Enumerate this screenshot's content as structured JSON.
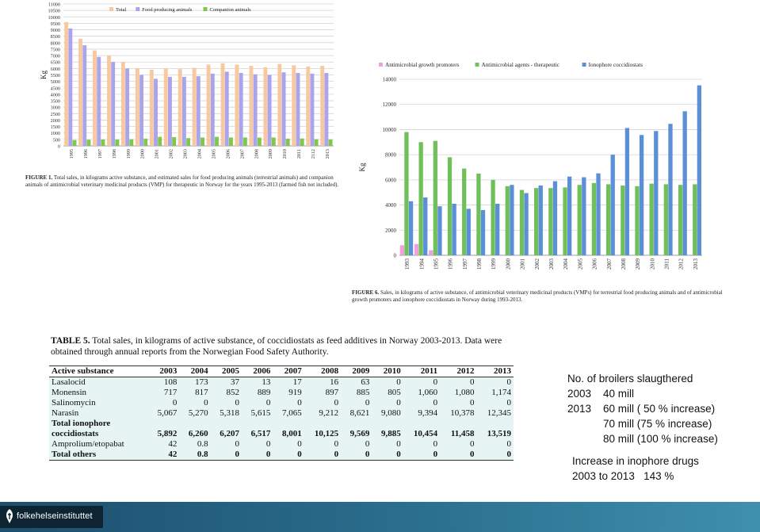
{
  "figure1": {
    "caption_bold": "FIGURE 1.",
    "caption_text": " Total sales, in kilograms active substance, and estimated sales for food producing animals (terrestrial animals) and companion animals of antimicrobial veterinary medicinal products (VMP) for therapeutic in Norway for the years 1995-2013 (farmed fish not included)."
  },
  "figure6": {
    "caption_bold": "FIGURE 6.",
    "caption_text": " Sales, in kilograms of active substance, of antimicrobial veterinary medicinal products (VMPs) for terrestrial food producing animals and of antimicrobial growth promoters and ionophore coccidiostats in Norway during 1993-2013."
  },
  "chart_data": [
    {
      "type": "bar",
      "ylabel": "Kg",
      "ylim": [
        0,
        11000
      ],
      "yticks": [
        "0",
        "500",
        "1000",
        "1500",
        "2000",
        "2500",
        "3000",
        "3500",
        "4000",
        "4500",
        "5000",
        "5500",
        "6000",
        "6500",
        "7000",
        "7500",
        "8000",
        "8500",
        "9000",
        "9500",
        "10000",
        "10500",
        "11000"
      ],
      "grid": true,
      "legend_position": "top",
      "categories": [
        "1995",
        "1996",
        "1997",
        "1998",
        "1999",
        "2000",
        "2001",
        "2002",
        "2003",
        "2004",
        "2005",
        "2006",
        "2007",
        "2008",
        "2009",
        "2010",
        "2011",
        "2112",
        "2013"
      ],
      "series": [
        {
          "name": "Total",
          "color": "#f8c9a0",
          "values": [
            9600,
            8300,
            7400,
            7000,
            6500,
            6000,
            5900,
            6000,
            5950,
            6050,
            6300,
            6400,
            6300,
            6200,
            6100,
            6350,
            6250,
            6150,
            6200
          ]
        },
        {
          "name": "Food producing animals",
          "color": "#a9a4ec",
          "values": [
            9100,
            7800,
            6900,
            6500,
            6000,
            5500,
            5200,
            5350,
            5350,
            5400,
            5600,
            5750,
            5650,
            5550,
            5500,
            5700,
            5650,
            5600,
            5650
          ]
        },
        {
          "name": "Companion animals",
          "color": "#7fc84a",
          "values": [
            450,
            480,
            500,
            500,
            520,
            560,
            700,
            680,
            600,
            650,
            700,
            650,
            650,
            640,
            650,
            560,
            570,
            520,
            500
          ]
        }
      ]
    },
    {
      "type": "bar",
      "ylabel": "Kg",
      "ylim": [
        0,
        14000
      ],
      "yticks": [
        "0",
        "2000",
        "4000",
        "6000",
        "8000",
        "10000",
        "12000",
        "14000"
      ],
      "grid": true,
      "legend_position": "top",
      "categories": [
        "1993",
        "1994",
        "1995",
        "1996",
        "1997",
        "1998",
        "1999",
        "2000",
        "2001",
        "2002",
        "2003",
        "2004",
        "2005",
        "2006",
        "2007",
        "2008",
        "2009",
        "2010",
        "2011",
        "2012",
        "2013"
      ],
      "series": [
        {
          "name": "Antimicrobial growth promoters",
          "color": "#f0a0dc",
          "values": [
            800,
            900,
            400,
            0,
            0,
            0,
            0,
            0,
            0,
            0,
            0,
            0,
            0,
            0,
            0,
            0,
            0,
            0,
            0,
            0,
            0
          ]
        },
        {
          "name": "Antimicrobial agents - therapeutic",
          "color": "#70c05a",
          "values": [
            9800,
            9000,
            9100,
            7800,
            6900,
            6500,
            6000,
            5500,
            5200,
            5350,
            5350,
            5400,
            5600,
            5750,
            5650,
            5550,
            5500,
            5700,
            5650,
            5600,
            5650
          ]
        },
        {
          "name": "Ionophore coccidiostats",
          "color": "#5b8fd8",
          "values": [
            4300,
            4600,
            3900,
            4100,
            3700,
            3600,
            4100,
            5600,
            4950,
            5550,
            5892,
            6260,
            6207,
            6517,
            8001,
            10125,
            9569,
            9885,
            10454,
            11458,
            13519
          ]
        }
      ]
    },
    {
      "type": "table",
      "title_bold": "TABLE 5.",
      "title_text": " Total sales, in kilograms of active substance, of coccidiostats as feed additives in Norway 2003-2013. Data were obtained through annual reports from the Norwegian Food Safety Authority.",
      "columns": [
        "Active substance",
        "2003",
        "2004",
        "2005",
        "2006",
        "2007",
        "2008",
        "2009",
        "2010",
        "2011",
        "2012",
        "2013"
      ],
      "rows": [
        {
          "cells": [
            "Lasalocid",
            "108",
            "173",
            "37",
            "13",
            "17",
            "16",
            "63",
            "0",
            "0",
            "0",
            "0"
          ]
        },
        {
          "cells": [
            "Monensin",
            "717",
            "817",
            "852",
            "889",
            "919",
            "897",
            "885",
            "805",
            "1,060",
            "1,080",
            "1,174"
          ]
        },
        {
          "cells": [
            "Salinomycin",
            "0",
            "0",
            "0",
            "0",
            "0",
            "0",
            "0",
            "0",
            "0",
            "0",
            "0"
          ]
        },
        {
          "cells": [
            "Narasin",
            "5,067",
            "5,270",
            "5,318",
            "5,615",
            "7,065",
            "9,212",
            "8,621",
            "9,080",
            "9,394",
            "10,378",
            "12,345"
          ]
        },
        {
          "cells": [
            "Total ionophore",
            "",
            "",
            "",
            "",
            "",
            "",
            "",
            "",
            "",
            "",
            ""
          ],
          "bold": true
        },
        {
          "cells": [
            "coccidiostats",
            "5,892",
            "6,260",
            "6,207",
            "6,517",
            "8,001",
            "10,125",
            "9,569",
            "9,885",
            "10,454",
            "11,458",
            "13,519"
          ],
          "bold": true
        },
        {
          "cells": [
            "Amprolium/etopabat",
            "42",
            "0.8",
            "0",
            "0",
            "0",
            "0",
            "0",
            "0",
            "0",
            "0",
            "0"
          ]
        },
        {
          "cells": [
            "Total others",
            "42",
            "0.8",
            "0",
            "0",
            "0",
            "0",
            "0",
            "0",
            "0",
            "0",
            "0"
          ],
          "bold": true
        }
      ]
    }
  ],
  "notes": {
    "broilers": "No. of broilers slaugthered\n2003    40 mill\n2013    60 mill ( 50 % increase)\n            70 mill (75 % increase)\n            80 mill (100 % increase)",
    "ionophore": "Increase in inophore drugs\n2003 to 2013   143 %"
  },
  "footer": {
    "logo_text": "folkehelseinstituttet"
  }
}
